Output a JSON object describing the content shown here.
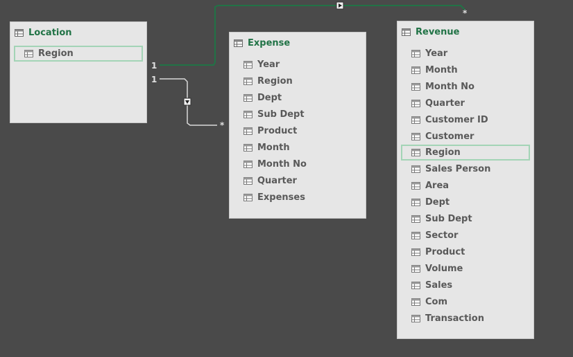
{
  "tables": [
    {
      "title": "Location",
      "fields": [
        "Region"
      ],
      "selected": 0
    },
    {
      "title": "Expense",
      "fields": [
        "Year",
        "Region",
        "Dept",
        "Sub Dept",
        "Product",
        "Month",
        "Month No",
        "Quarter",
        "Expenses"
      ],
      "selected": -1
    },
    {
      "title": "Revenue",
      "fields": [
        "Year",
        "Month",
        "Month No",
        "Quarter",
        "Customer ID",
        "Customer",
        "Region",
        "Sales Person",
        "Area",
        "Dept",
        "Sub Dept",
        "Sector",
        "Product",
        "Volume",
        "Sales",
        "Com",
        "Transaction"
      ],
      "selected": 6
    }
  ],
  "relationships": [
    {
      "from": "Location",
      "to": "Revenue",
      "from_cardinality": "1",
      "to_cardinality": "*",
      "active": true
    },
    {
      "from": "Location",
      "to": "Expense",
      "from_cardinality": "1",
      "to_cardinality": "*",
      "active": false
    }
  ],
  "colors": {
    "accent": "#217346",
    "background": "#4a4a4a",
    "card": "#e6e6e6",
    "selection": "#a3d4b6"
  }
}
